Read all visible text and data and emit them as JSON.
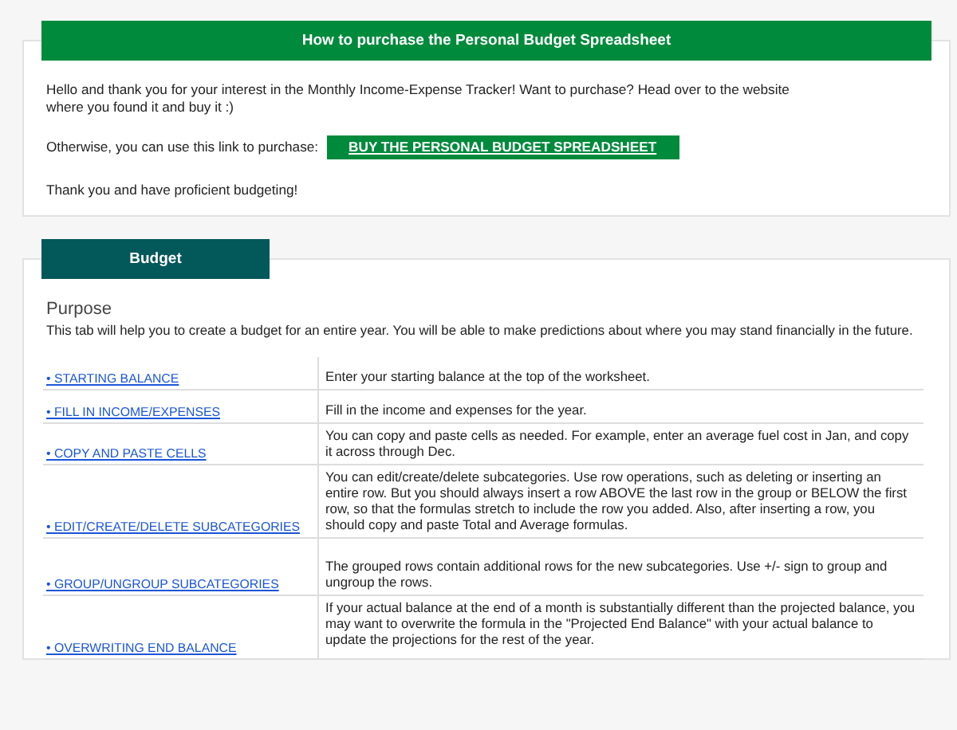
{
  "purchase": {
    "title": "How to purchase the Personal Budget Spreadsheet",
    "intro": "Hello and thank you for your interest in the Monthly Income-Expense Tracker! Want to purchase? Head over to the website where you found it and buy it :)",
    "link_prompt": "Otherwise, you can use this link to purchase:",
    "link_button": "BUY THE PERSONAL BUDGET SPREADSHEET",
    "closing": "Thank you and have proficient budgeting!"
  },
  "budget": {
    "tab": "Budget",
    "heading": "Purpose",
    "description": "This tab will help you to create a budget for an entire year. You will be able to make predictions about where you may stand financially in the future.",
    "rows": [
      {
        "link": "• STARTING BALANCE",
        "text": "Enter your starting balance at the top of the worksheet."
      },
      {
        "link": "• FILL IN INCOME/EXPENSES",
        "text": "Fill in the income and expenses for the year."
      },
      {
        "link": "• COPY AND PASTE CELLS",
        "text": "You can copy and paste cells as needed. For example, enter an average fuel cost in Jan, and copy it across through Dec."
      },
      {
        "link": "• EDIT/CREATE/DELETE SUBCATEGORIES",
        "text": "You can edit/create/delete subcategories. Use row operations, such as deleting or inserting an entire row. But you should always insert a row ABOVE the last row in the group or BELOW the first row, so that the formulas stretch to include the row you added. Also, after inserting a row, you should copy and paste Total and Average formulas."
      },
      {
        "link": "• GROUP/UNGROUP SUBCATEGORIES",
        "text": "The grouped rows contain additional rows for the new subcategories. Use +/- sign to group and ungroup the rows."
      },
      {
        "link": "• OVERWRITING END BALANCE",
        "text": "If your actual balance at the end of a month is substantially different than the projected balance, you may want to overwrite the formula in the \"Projected End Balance\" with your actual balance to update the projections for the rest of the year."
      }
    ]
  }
}
